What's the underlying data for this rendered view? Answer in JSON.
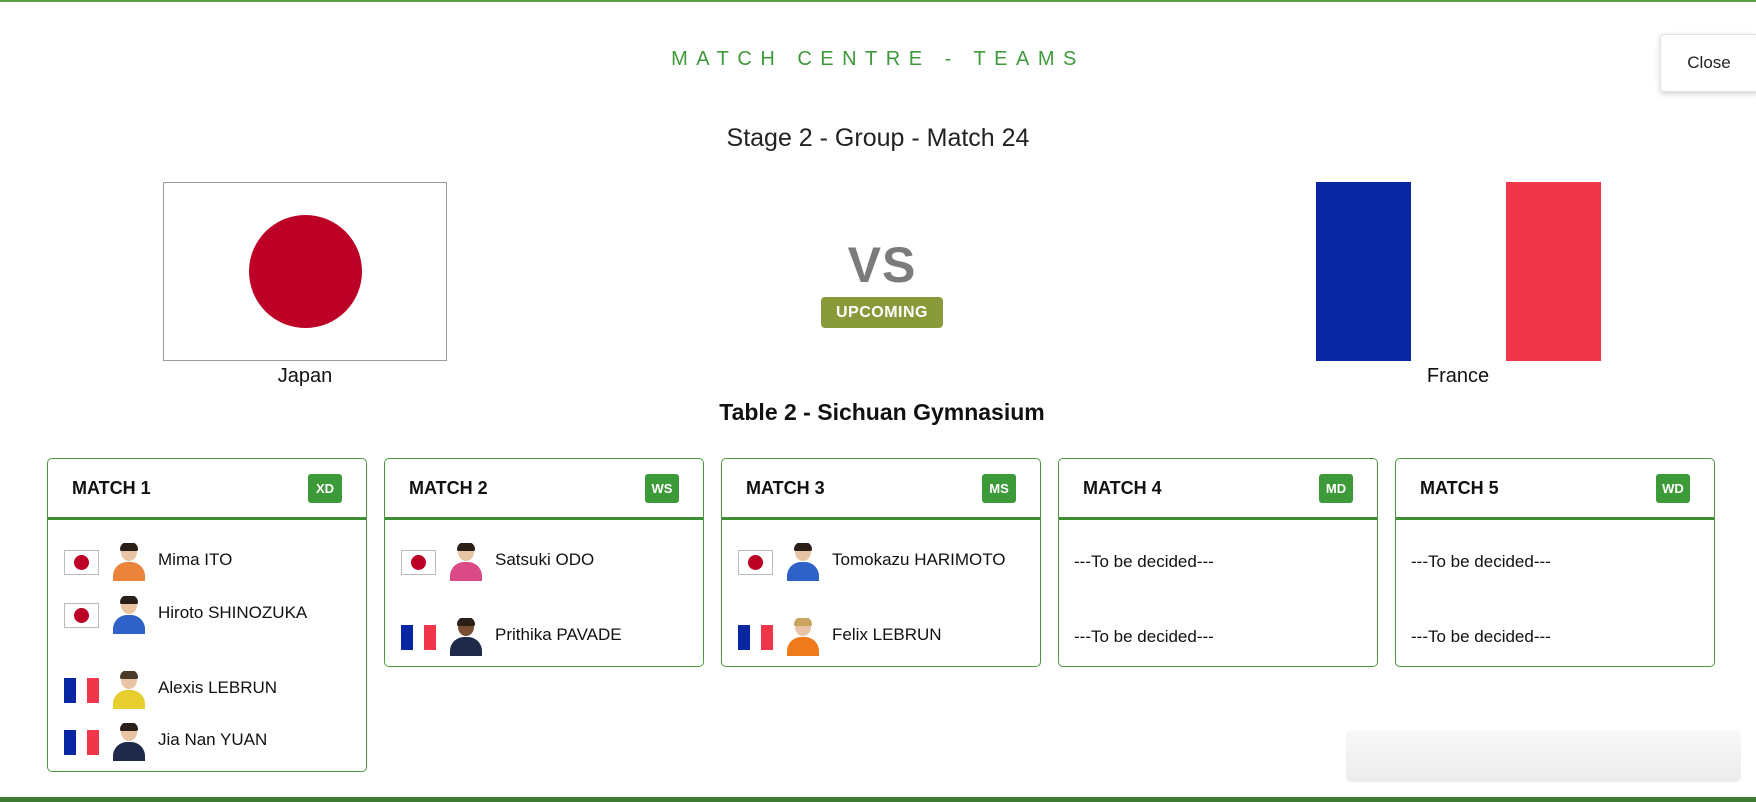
{
  "modal": {
    "title": "MATCH CENTRE - TEAMS",
    "close_label": "Close"
  },
  "match": {
    "stage": "Stage 2 - Group - Match 24",
    "vs": "VS",
    "status": "UPCOMING",
    "status_color": "#889a3a",
    "venue": "Table 2 - Sichuan Gymnasium"
  },
  "teams": {
    "home": {
      "name": "Japan",
      "flag": "flag-japan"
    },
    "away": {
      "name": "France",
      "flag": "flag-france"
    }
  },
  "colors": {
    "accent_green": "#3d9a38",
    "japan_red": "#bc0026",
    "france_blue": "#0a27a3",
    "france_red": "#f0364a"
  },
  "matches": [
    {
      "label": "MATCH 1",
      "badge": "XD",
      "home_players": [
        "Mima ITO",
        "Hiroto SHINOZUKA"
      ],
      "away_players": [
        "Alexis LEBRUN",
        "Jia Nan YUAN"
      ]
    },
    {
      "label": "MATCH 2",
      "badge": "WS",
      "home_players": [
        "Satsuki ODO"
      ],
      "away_players": [
        "Prithika PAVADE"
      ]
    },
    {
      "label": "MATCH 3",
      "badge": "MS",
      "home_players": [
        "Tomokazu HARIMOTO"
      ],
      "away_players": [
        "Felix LEBRUN"
      ]
    },
    {
      "label": "MATCH 4",
      "badge": "MD",
      "home_tbd": "---To be decided---",
      "away_tbd": "---To be decided---"
    },
    {
      "label": "MATCH 5",
      "badge": "WD",
      "home_tbd": "---To be decided---",
      "away_tbd": "---To be decided---"
    }
  ]
}
